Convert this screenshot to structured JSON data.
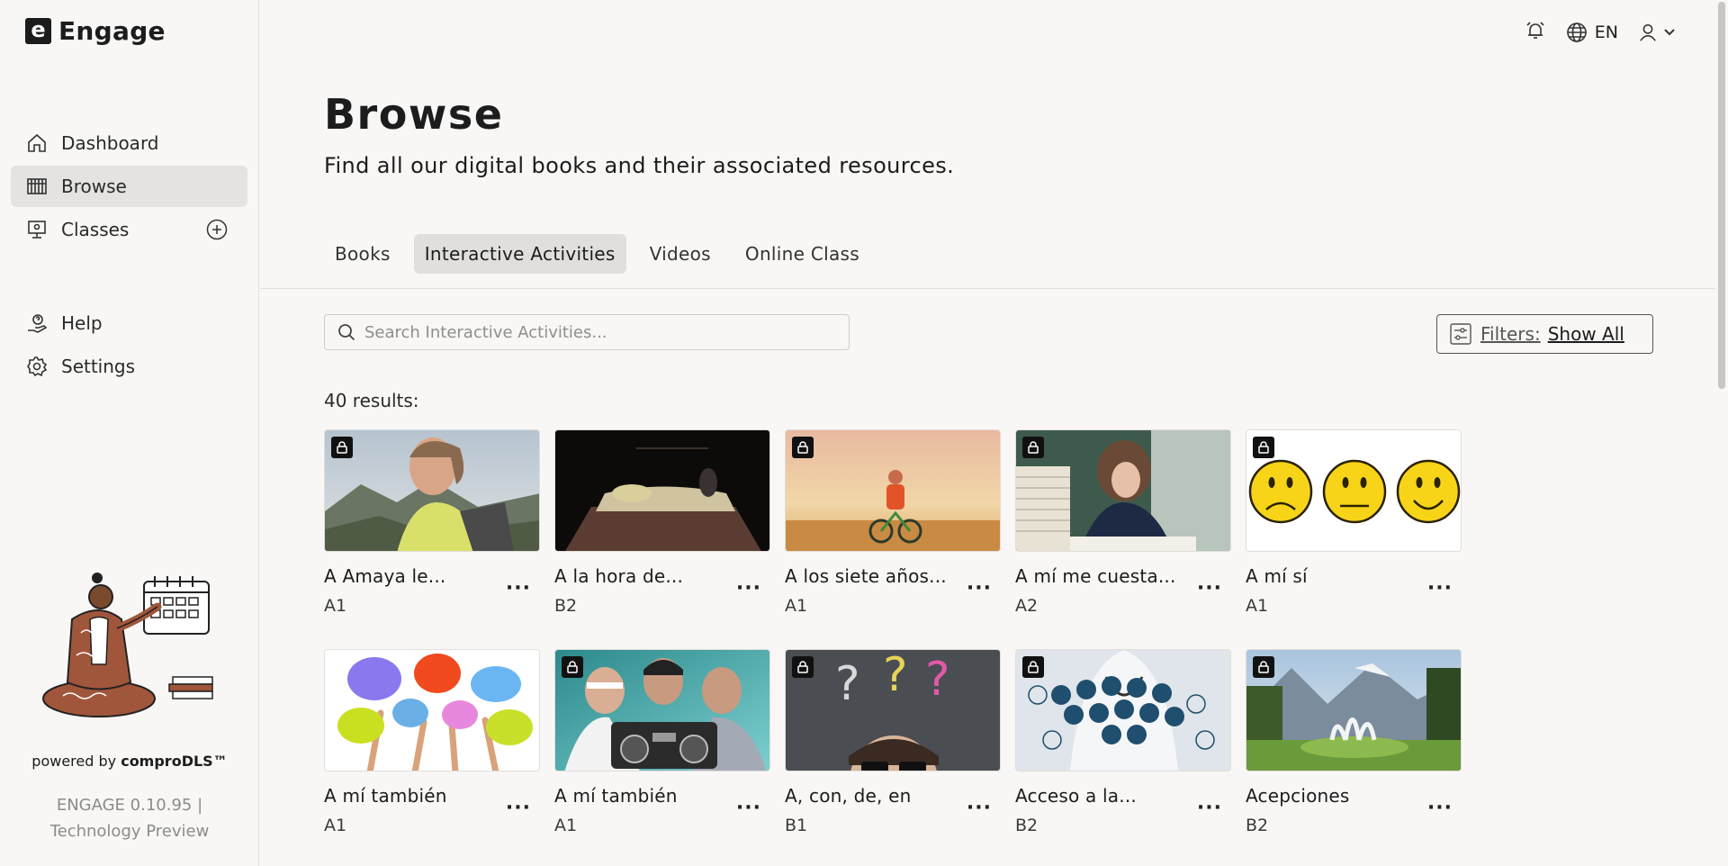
{
  "app": {
    "logo_letter": "e",
    "name": "Engage"
  },
  "sidebar": {
    "items": [
      {
        "label": "Dashboard",
        "icon": "home-icon"
      },
      {
        "label": "Browse",
        "icon": "library-icon",
        "active": true
      },
      {
        "label": "Classes",
        "icon": "presentation-icon",
        "action_icon": "add-circle-icon"
      }
    ],
    "secondary": [
      {
        "label": "Help",
        "icon": "help-hand-icon"
      },
      {
        "label": "Settings",
        "icon": "gear-icon"
      }
    ],
    "powered_by": "powered by",
    "powered_brand": "comproDLS™",
    "version_line1": "ENGAGE 0.10.95 |",
    "version_line2": "Technology Preview"
  },
  "topbar": {
    "language": "EN",
    "notification_icon": "alarm-icon",
    "globe_icon": "globe-icon",
    "user_icon": "user-icon"
  },
  "page": {
    "title": "Browse",
    "subtitle": "Find all our digital books and their associated resources."
  },
  "tabs": [
    {
      "label": "Books"
    },
    {
      "label": "Interactive Activities",
      "active": true
    },
    {
      "label": "Videos"
    },
    {
      "label": "Online Class"
    }
  ],
  "search": {
    "placeholder": "Search Interactive Activities...",
    "value": ""
  },
  "filters": {
    "label": "Filters:",
    "value": "Show All"
  },
  "results": {
    "count_text": "40 results:",
    "items": [
      {
        "title": "A Amaya le...",
        "level": "A1",
        "locked": true,
        "image": "woman-mountain"
      },
      {
        "title": "A la hora de...",
        "level": "B2",
        "locked": false,
        "image": "dark-bedroom"
      },
      {
        "title": "A los siete años...",
        "level": "A1",
        "locked": true,
        "image": "child-bike-beach"
      },
      {
        "title": "A mí me cuesta...",
        "level": "A2",
        "locked": true,
        "image": "stressed-student"
      },
      {
        "title": "A mí sí",
        "level": "A1",
        "locked": true,
        "image": "smiley-faces"
      },
      {
        "title": "A mí también",
        "level": "A1",
        "locked": false,
        "image": "speech-bubbles"
      },
      {
        "title": "A mí también",
        "level": "A1",
        "locked": true,
        "image": "boys-boombox"
      },
      {
        "title": "A, con, de, en",
        "level": "B1",
        "locked": true,
        "image": "question-marks"
      },
      {
        "title": "Acceso a la...",
        "level": "B2",
        "locked": true,
        "image": "medical-icons"
      },
      {
        "title": "Acepciones",
        "level": "B2",
        "locked": true,
        "image": "fountain-park"
      }
    ]
  }
}
